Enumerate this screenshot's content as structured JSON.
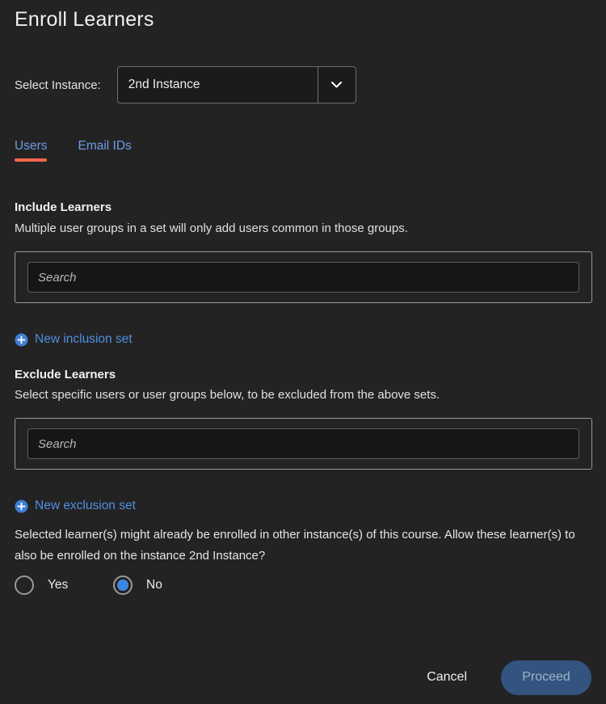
{
  "dialog": {
    "title": "Enroll Learners"
  },
  "instance": {
    "label": "Select Instance:",
    "selected": "2nd Instance",
    "options": [
      "2nd Instance"
    ],
    "chevron_icon": "chevron-down-icon"
  },
  "tabs": [
    {
      "label": "Users",
      "active": true
    },
    {
      "label": "Email IDs",
      "active": false
    }
  ],
  "include": {
    "heading": "Include Learners",
    "description": "Multiple user groups in a set will only add users common in those groups.",
    "search_placeholder": "Search",
    "search_value": "",
    "new_set_label": "New inclusion set",
    "new_set_icon": "plus-circle-icon"
  },
  "exclude": {
    "heading": "Exclude Learners",
    "description": "Select specific users or user groups below, to be excluded from the above sets.",
    "search_placeholder": "Search",
    "search_value": "",
    "new_set_label": "New exclusion set",
    "new_set_icon": "plus-circle-icon"
  },
  "enrollment_note": {
    "text": "Selected learner(s) might already be enrolled in other instance(s) of this course. Allow these learner(s) to also be enrolled on the instance 2nd Instance?"
  },
  "allow_radio": {
    "options": [
      {
        "label": "Yes",
        "selected": false
      },
      {
        "label": "No",
        "selected": true
      }
    ]
  },
  "footer": {
    "cancel_label": "Cancel",
    "proceed_label": "Proceed",
    "proceed_disabled": true
  },
  "colors": {
    "background": "#232323",
    "tab_text": "#6c9ce8",
    "tab_active_underline": "#f2674a",
    "link_blue": "#4f8fe0",
    "radio_selected": "#3b87df",
    "proceed_bg": "#32547f",
    "proceed_text": "#9fb2c8"
  }
}
